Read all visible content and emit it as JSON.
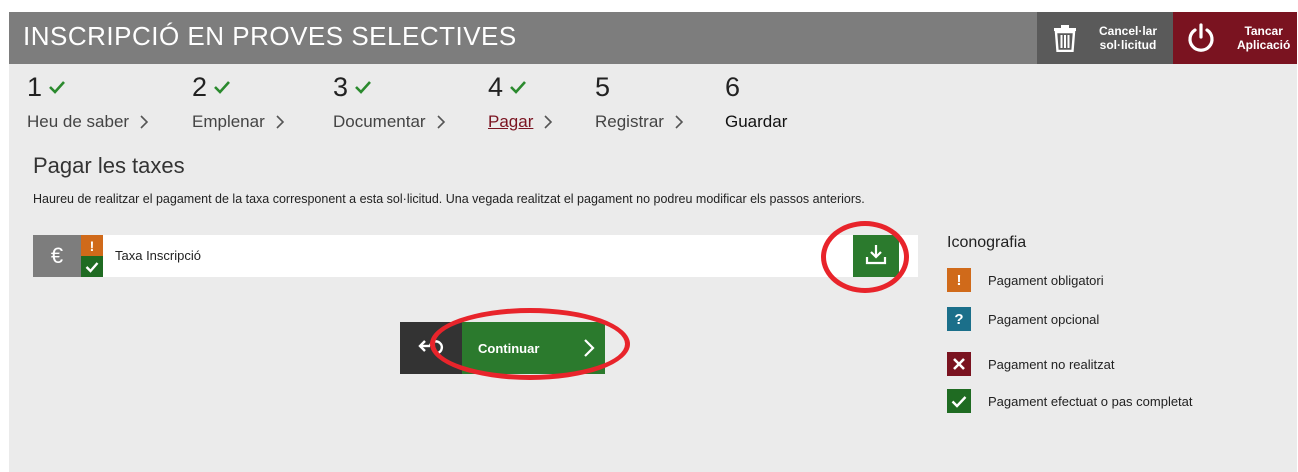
{
  "header": {
    "title": "INSCRIPCIÓ EN PROVES SELECTIVES",
    "cancel_label": "Cancel·lar\nsol·licitud",
    "close_label": "Tancar\nAplicació"
  },
  "steps": [
    {
      "number": "1",
      "label": "Heu de saber",
      "completed": true
    },
    {
      "number": "2",
      "label": "Emplenar",
      "completed": true
    },
    {
      "number": "3",
      "label": "Documentar",
      "completed": true
    },
    {
      "number": "4",
      "label": "Pagar",
      "completed": true,
      "active": true
    },
    {
      "number": "5",
      "label": "Registrar",
      "completed": false
    },
    {
      "number": "6",
      "label": "Guardar",
      "completed": false,
      "current": true
    }
  ],
  "section": {
    "title": "Pagar les taxes",
    "description": "Haureu de realitzar el pagament de la taxa corresponent a esta sol·licitud. Una vegada realitzat el pagament no podreu modificar els passos anteriors."
  },
  "fee": {
    "currency_symbol": "€",
    "warn_symbol": "!",
    "label": "Taxa Inscripció"
  },
  "legend": {
    "title": "Iconografia",
    "items": [
      {
        "symbol": "!",
        "label": "Pagament obligatori",
        "color": "#d06a1a"
      },
      {
        "symbol": "?",
        "label": "Pagament opcional",
        "color": "#1b6f8a"
      },
      {
        "symbol": "",
        "label": "Pagament no realitzat",
        "color": "#7a1320"
      },
      {
        "symbol": "",
        "label": "Pagament efectuat o pas completat",
        "color": "#1f6b22"
      }
    ]
  },
  "navigation": {
    "continue_label": "Continuar"
  },
  "colors": {
    "header_bg": "#7d7d7d",
    "accent_red": "#7a1320",
    "success_green": "#2b7a2d",
    "highlight_ring": "#e8242b"
  }
}
